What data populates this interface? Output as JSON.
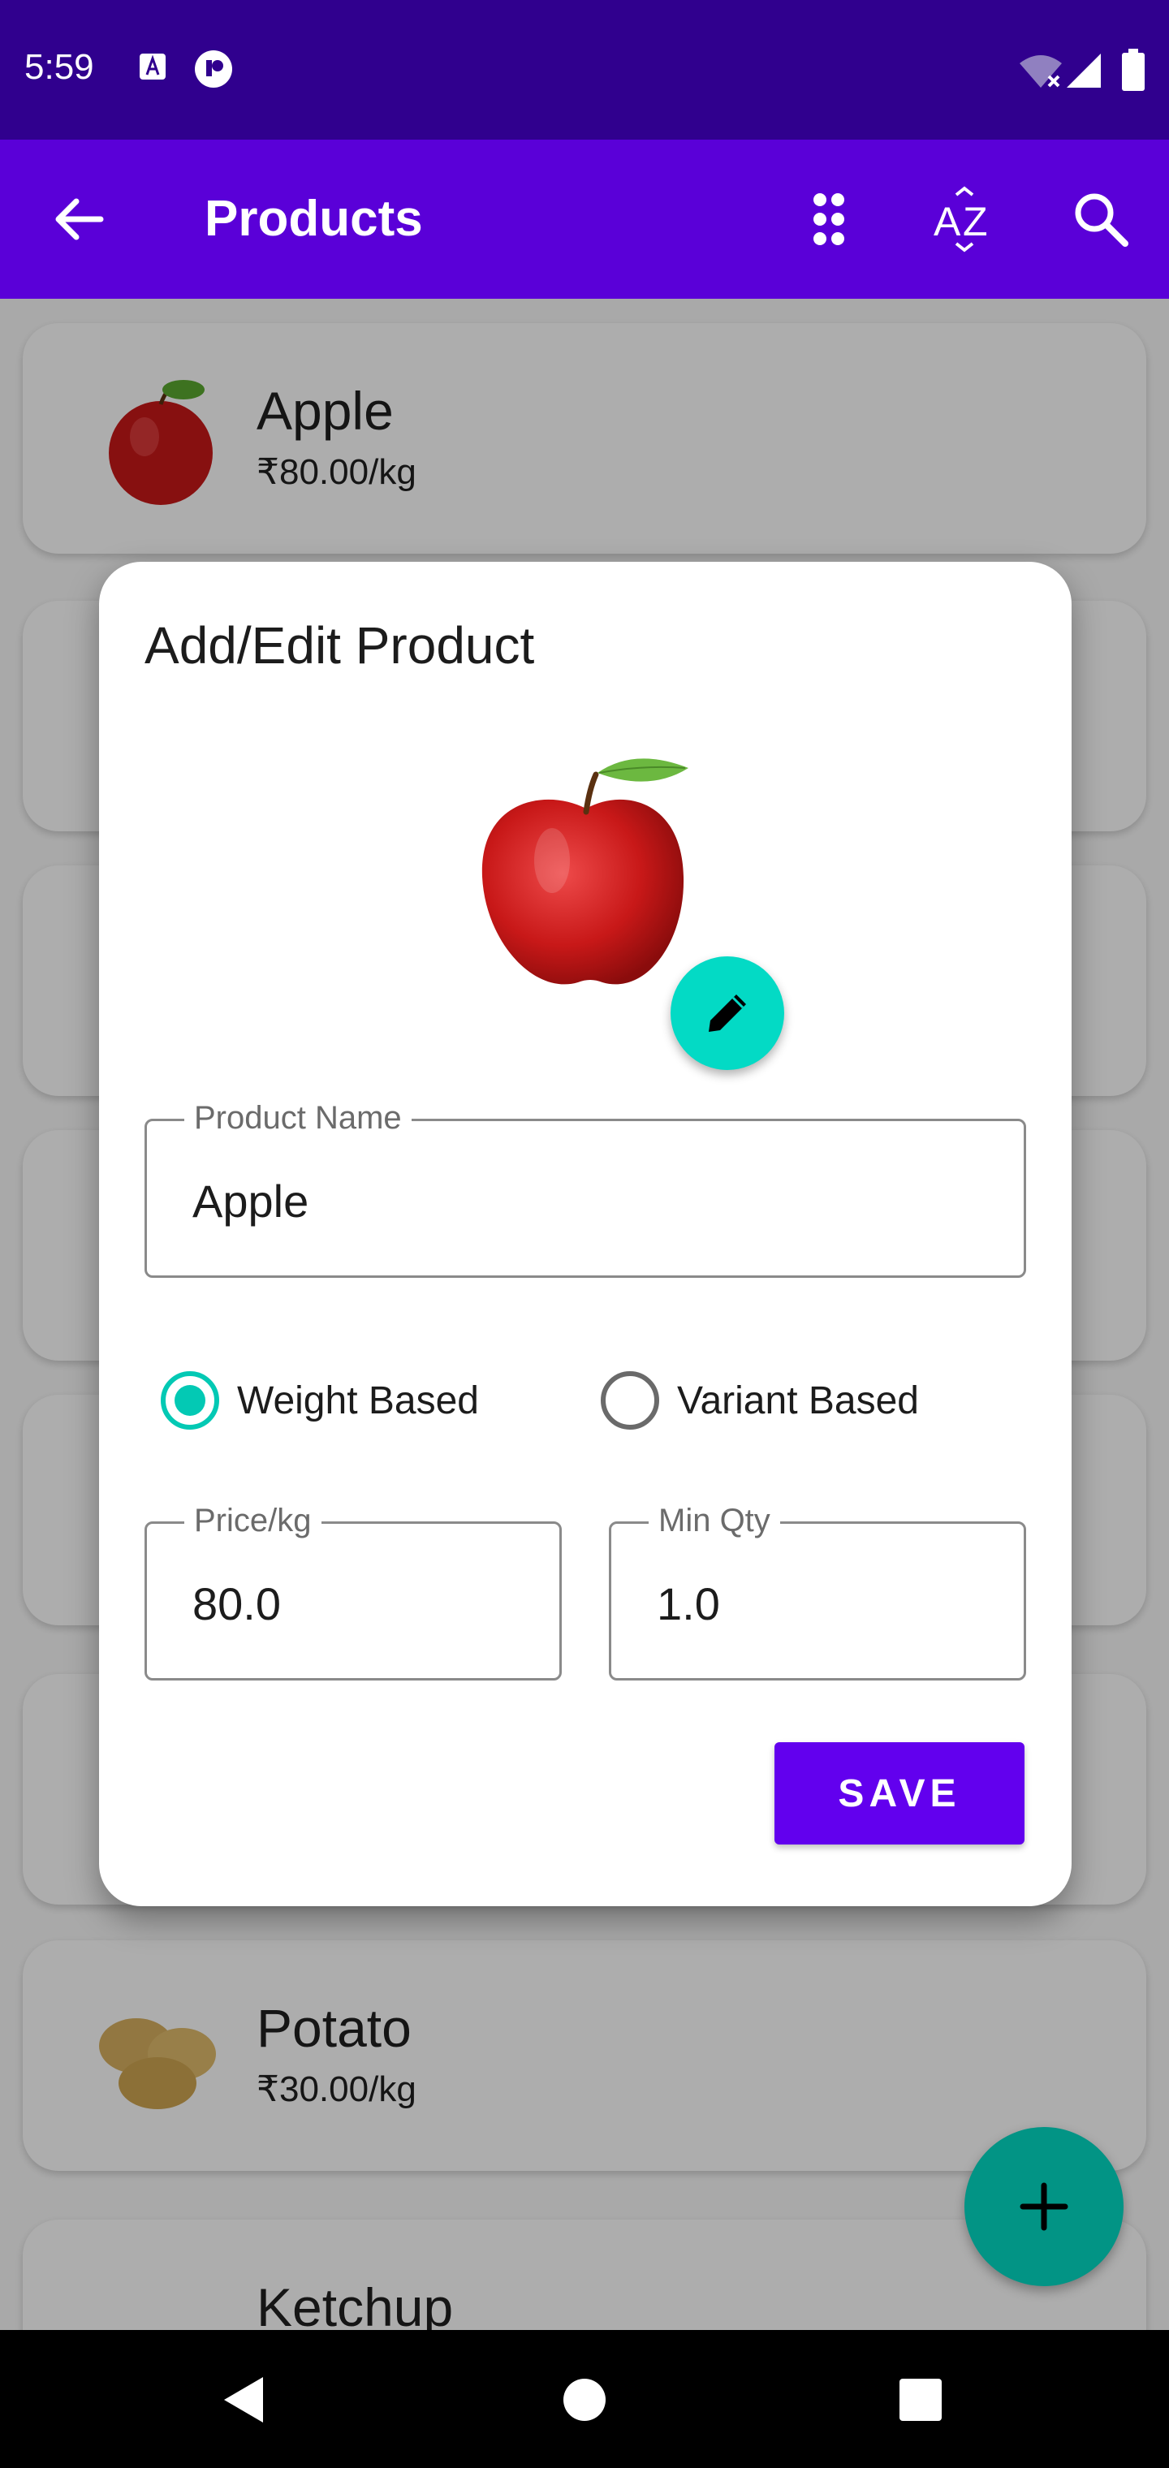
{
  "status_bar": {
    "time": "5:59",
    "icons": [
      "accessibility-a-icon",
      "record-icon",
      "wifi-off-icon",
      "signal-icon",
      "battery-icon"
    ]
  },
  "app_bar": {
    "title": "Products",
    "actions": [
      "back-arrow-icon",
      "grid-icon",
      "sort-az-icon",
      "search-icon"
    ]
  },
  "products": [
    {
      "name": "Apple",
      "price": "₹80.00/kg"
    },
    {
      "name": "Potato",
      "price": "₹30.00/kg"
    },
    {
      "name": "Ketchup",
      "price": ""
    }
  ],
  "dialog": {
    "title": "Add/Edit Product",
    "product_name_label": "Product Name",
    "product_name_value": "Apple",
    "weight_based_label": "Weight Based",
    "variant_based_label": "Variant Based",
    "selected_option": "Weight Based",
    "price_label": "Price/kg",
    "price_value": "80.0",
    "min_qty_label": "Min Qty",
    "min_qty_value": "1.0",
    "save_label": "SAVE"
  },
  "colors": {
    "status_bar": "#30008e",
    "app_bar": "#5a00d8",
    "accent": "#03dac5",
    "primary_button": "#6200ee"
  }
}
